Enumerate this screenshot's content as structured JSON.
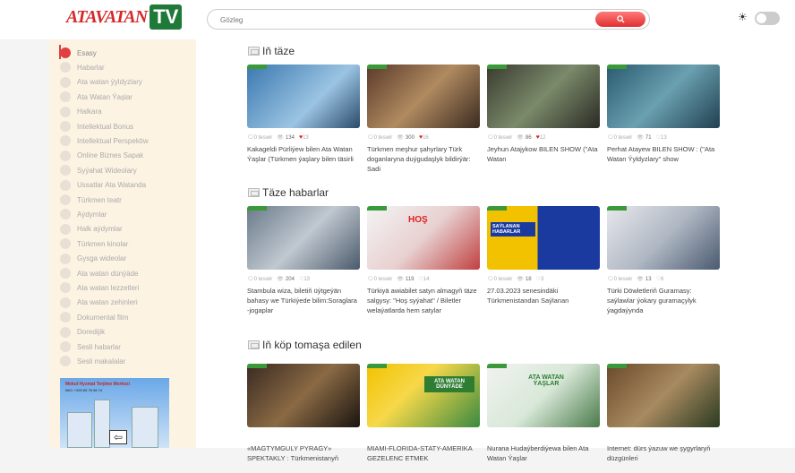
{
  "header": {
    "logo_text": "ATAVATAN",
    "logo_tv": "TV",
    "search_placeholder": "Gözleg"
  },
  "sidebar": {
    "items": [
      {
        "label": "Esasy",
        "active": true
      },
      {
        "label": "Habarlar"
      },
      {
        "label": "Ata watan ýyldyzlary"
      },
      {
        "label": "Ata Watan Ýaşlar"
      },
      {
        "label": "Halkara"
      },
      {
        "label": "Intellektual Bonus"
      },
      {
        "label": "Intellektual Perspektiw"
      },
      {
        "label": "Online Biznes Sapak"
      },
      {
        "label": "Syýahat Wideolary"
      },
      {
        "label": "Ussatlar Ata Watanda"
      },
      {
        "label": "Türkmen teatr"
      },
      {
        "label": "Aýdymlar"
      },
      {
        "label": "Halk aýdymlar"
      },
      {
        "label": "Türkmen kinolar"
      },
      {
        "label": "Gysga wideolar"
      },
      {
        "label": "Ata watan dünýäde"
      },
      {
        "label": "Ata watan lezzetleri"
      },
      {
        "label": "Ata watan zehinleri"
      },
      {
        "label": "Dokumental film"
      },
      {
        "label": "Doredijik"
      },
      {
        "label": "Sesli habarlar"
      },
      {
        "label": "Sesli makalalar"
      }
    ],
    "ad": {
      "title": "Mekul Hyzmat Terjime Merkezi",
      "phone": "IMO: +993 65 78 98 74"
    }
  },
  "sections": [
    {
      "title": "Iň täze",
      "cards": [
        {
          "comments": "0 teswir",
          "views": "134",
          "likes": "13",
          "liked": true,
          "title": "Kakageldi Pürliýew bilen Ata Watan Ýaşlar (Türkmen ýaşlary bilen täsirli"
        },
        {
          "comments": "0 teswir",
          "views": "300",
          "likes": "16",
          "liked": true,
          "title": "Türkmen meşhur şahyrlary Türk doganlaryna duýgudaşlyk bildirýär: Sadi"
        },
        {
          "comments": "0 teswir",
          "views": "86",
          "likes": "12",
          "liked": true,
          "title": "Jeyhun Atajykow BILEN SHOW (\"Ata Watan"
        },
        {
          "comments": "0 teswir",
          "views": "71",
          "likes": "13",
          "liked": false,
          "title": "Perhat Atayew BILEN SHOW : (\"Ata Watan Ýyldyzlary\" show"
        }
      ]
    },
    {
      "title": "Täze habarlar",
      "cards": [
        {
          "comments": "0 teswir",
          "views": "204",
          "likes": "13",
          "liked": false,
          "title": "Stambula wiza, biletiň üýtgeýän bahasy we Türkiýede bilim:Soraglara -jogaplar"
        },
        {
          "comments": "0 teswir",
          "views": "119",
          "likes": "14",
          "liked": false,
          "title": "Türkiyä awiabilet satyn almagyň täze salgysy: \"Hoş syýahat\" / Biletler welaýatlarda hem satylar"
        },
        {
          "comments": "0 teswir",
          "views": "18",
          "likes": "3",
          "liked": false,
          "title": "27.03.2023 senesindäki Türkmenistandan Saýlanan"
        },
        {
          "comments": "0 teswir",
          "views": "13",
          "likes": "6",
          "liked": false,
          "title": "Türki Döwletleriň Guramasy: saýlawlar ýokary guramaçylyk ýagdaýynda"
        }
      ]
    },
    {
      "title": "Iň köp tomaşa edilen",
      "cards": [
        {
          "title": "«MAGTYMGULY PYRAGY» SPEKTAKLY : Türkmenistanyň"
        },
        {
          "title": "MIAMI-FLORIDA-STATY-AMERIKA GEZELENC ETMEK"
        },
        {
          "title": "Nurana Hudaýberdiýewa bilen Ata Watan Ýaşlar"
        },
        {
          "title": "Internet: dürs ýazuw we şygyrlaryň düzgünleri"
        }
      ]
    }
  ],
  "thumb_labels": {
    "saylanan": "SAÝLANAN HABARLAR",
    "hos": "HOŞ",
    "ata_watan_dunyade": "ATA WATAN DÜNÝÄDE",
    "ata_watan_yaslar": "ATA WATAN ÝAŞLAR"
  }
}
